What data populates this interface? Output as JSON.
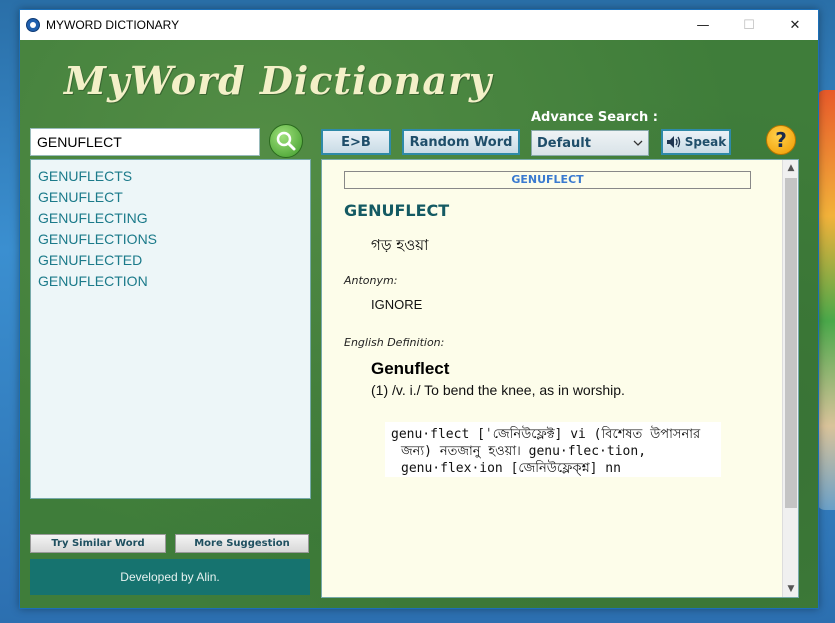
{
  "window": {
    "title": "MYWORD DICTIONARY",
    "minimize": "—",
    "maximize": "☐",
    "close": "✕"
  },
  "logo": "MyWord Dictionary",
  "search": {
    "value": "GENUFLECT"
  },
  "suggestions": [
    "GENUFLECTS",
    "GENUFLECT",
    "GENUFLECTING",
    "GENUFLECTIONS",
    "GENUFLECTED",
    "GENUFLECTION"
  ],
  "buttons": {
    "try_similar": "Try Similar Word",
    "more_suggestion": "More Suggestion",
    "e_to_b": "E>B",
    "random_word": "Random Word",
    "speak": "Speak",
    "help": "?"
  },
  "footer": "Developed by Alin.",
  "advance_search": {
    "label": "Advance Search :",
    "selected": "Default"
  },
  "content": {
    "header_word": "GENUFLECT",
    "word": "GENUFLECT",
    "bengali_meaning": "গড় হওয়া",
    "antonym_label": "Antonym:",
    "antonym": "IGNORE",
    "definition_label": "English Definition:",
    "definition_word": "Genuflect",
    "definition_text": "(1) /v. i./ To bend the knee, as in worship.",
    "scan_lines": [
      "genu·flect [ˈজেনিউফ্লেক্ট] vi (বিশেষত উপাসনার",
      "জন্য)  নতজানু  হওয়া।    genu·flec·tion,",
      "genu·flex·ion [জেনিউফ্লেক্শ্ন] nn"
    ]
  },
  "colors": {
    "background": "#3f7d3a",
    "accent": "#1b7a8a",
    "footer": "#16736f",
    "content_bg": "#fdfdea"
  }
}
